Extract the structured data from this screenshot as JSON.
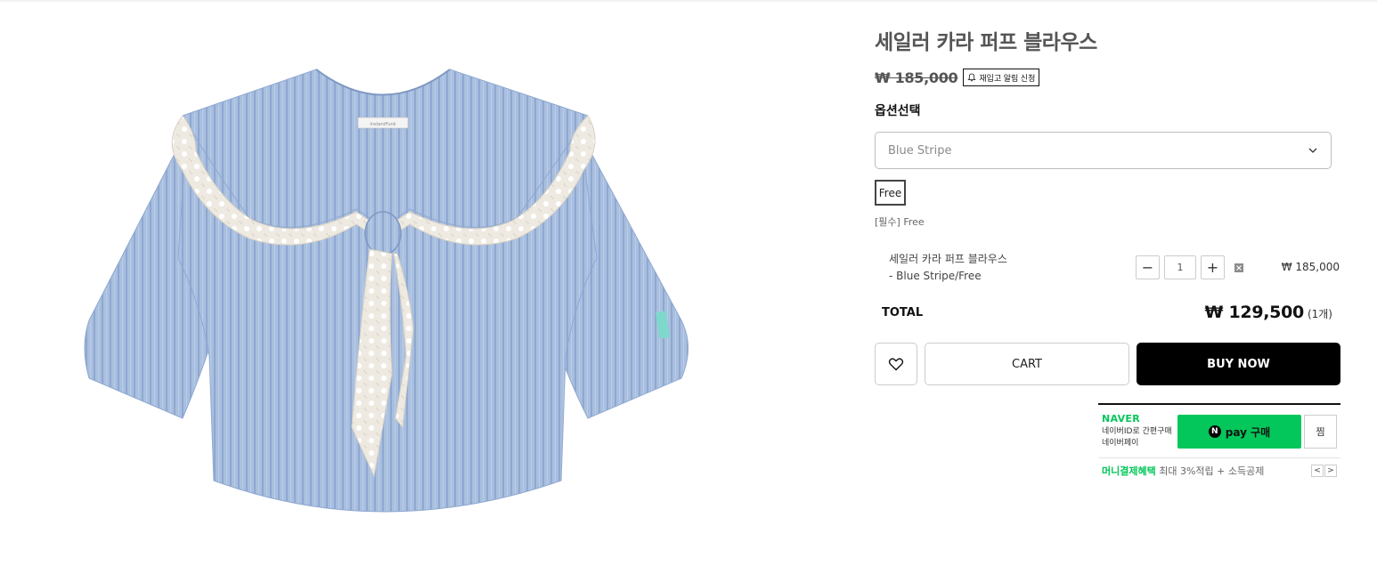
{
  "product": {
    "title": "세일러 카라 퍼프 블라우스",
    "original_price": "₩ 185,000",
    "restock_button": "재입고 알림 신청",
    "image_tag_text": "instantFunk"
  },
  "options": {
    "heading": "옵션선택",
    "select_value": "Blue Stripe",
    "size_chip": "Free",
    "required_label": "[필수] Free"
  },
  "line_item": {
    "name": "세일러 카라 퍼프 블라우스",
    "variant": "- Blue Stripe/Free",
    "quantity": "1",
    "price": "₩ 185,000"
  },
  "total": {
    "label": "TOTAL",
    "amount": "₩ 129,500",
    "count": "(1개)"
  },
  "actions": {
    "cart": "CART",
    "buy_now": "BUY NOW"
  },
  "naver_pay": {
    "brand": "NAVER",
    "sub_line1": "네이버ID로 간편구매",
    "sub_line2": "네이버페이",
    "button_label": "pay 구매",
    "button_n": "N",
    "wish_label": "찜",
    "benefit_green": "머니결제혜택",
    "benefit_gray": "최대 3%적립 + 소득공제",
    "accent_color": "#03c75a"
  },
  "icons": {
    "restock": "bell-icon",
    "select": "chevron-down-icon",
    "wish": "heart-icon",
    "remove": "close-icon"
  }
}
